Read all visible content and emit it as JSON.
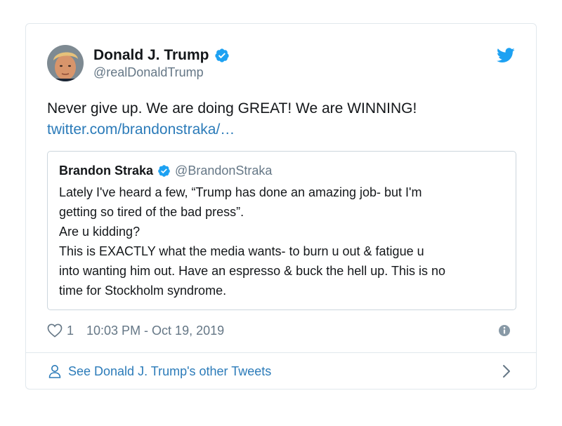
{
  "author": {
    "name": "Donald J. Trump",
    "handle": "@realDonaldTrump",
    "verified": true
  },
  "tweet": {
    "text": "Never give up. We are doing GREAT! We are WINNING!",
    "link": "twitter.com/brandonstraka/…"
  },
  "quote": {
    "name": "Brandon Straka",
    "handle": "@BrandonStraka",
    "verified": true,
    "lines": [
      "Lately I've heard a few, “Trump has done an amazing job- but I'm",
      "getting so tired of the bad press”.",
      "Are u kidding?",
      "This is EXACTLY what the media wants- to burn u out & fatigue u",
      "into wanting him out. Have an espresso & buck the hell up. This is no",
      "time for Stockholm syndrome."
    ]
  },
  "meta": {
    "likes": "1",
    "timestamp": "10:03 PM - Oct 19, 2019"
  },
  "footer": {
    "label": "See Donald J. Trump's other Tweets"
  },
  "colors": {
    "accent": "#1da1f2",
    "link": "#2b7bb9",
    "secondary": "#657786",
    "border": "#e1e8ed"
  },
  "icons": {
    "verified": "verified-badge-icon",
    "brand": "twitter-bird-icon",
    "like": "heart-icon",
    "info": "info-icon",
    "profile": "person-icon",
    "more": "chevron-right-icon"
  }
}
